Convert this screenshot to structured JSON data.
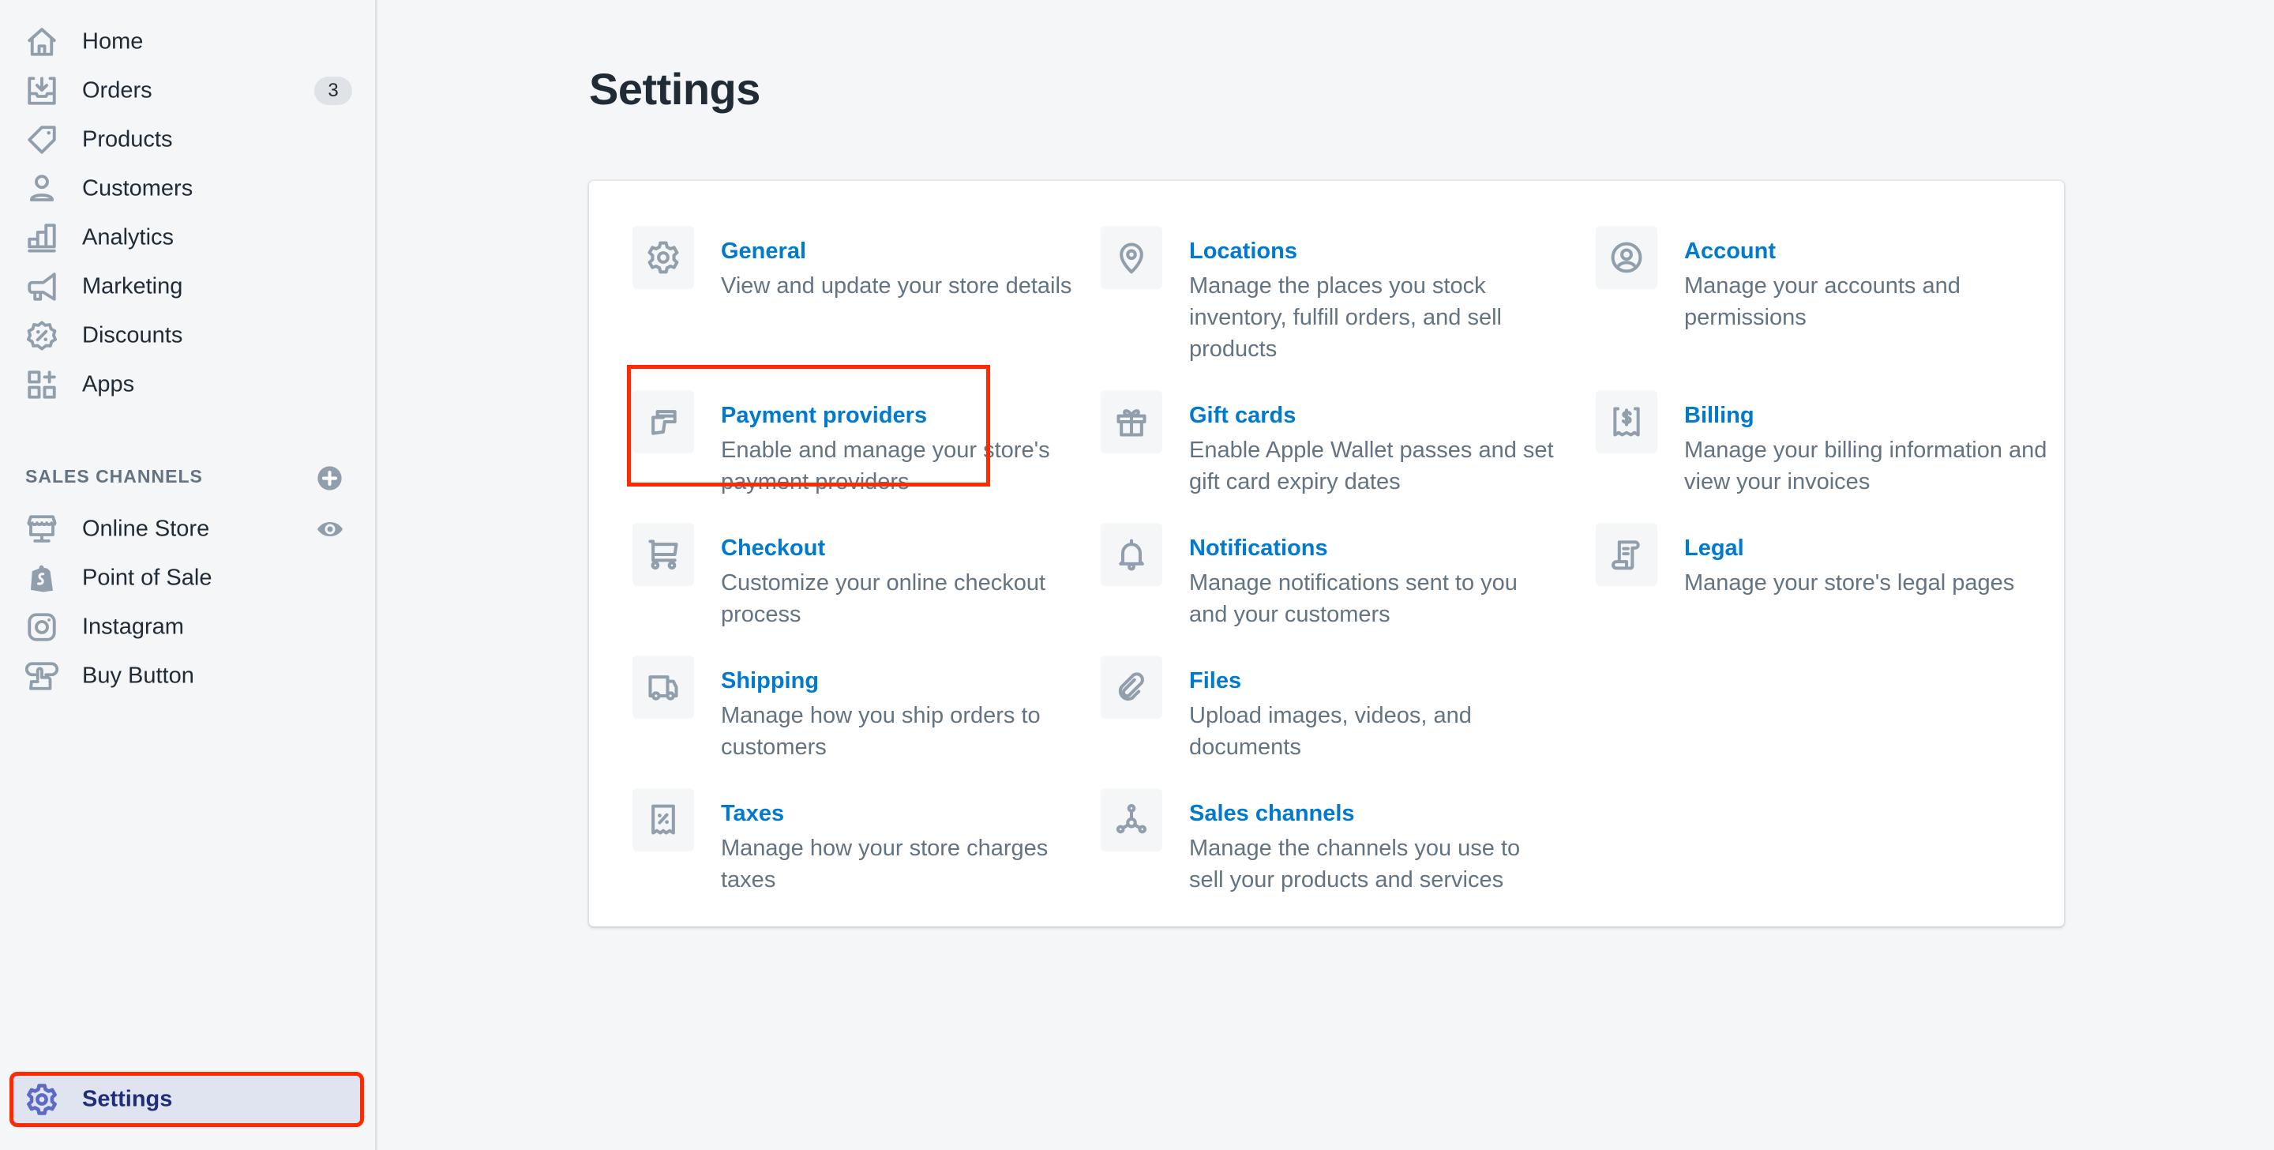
{
  "sidebar": {
    "items": [
      {
        "label": "Home",
        "icon": "home-icon"
      },
      {
        "label": "Orders",
        "icon": "orders-icon",
        "badge": "3"
      },
      {
        "label": "Products",
        "icon": "tag-icon"
      },
      {
        "label": "Customers",
        "icon": "person-icon"
      },
      {
        "label": "Analytics",
        "icon": "bar-chart-icon"
      },
      {
        "label": "Marketing",
        "icon": "megaphone-icon"
      },
      {
        "label": "Discounts",
        "icon": "discount-icon"
      },
      {
        "label": "Apps",
        "icon": "apps-icon"
      }
    ],
    "sales_channels": {
      "heading": "SALES CHANNELS",
      "items": [
        {
          "label": "Online Store",
          "icon": "storefront-icon"
        },
        {
          "label": "Point of Sale",
          "icon": "shopify-bag-icon"
        },
        {
          "label": "Instagram",
          "icon": "instagram-icon"
        },
        {
          "label": "Buy Button",
          "icon": "buy-button-icon"
        }
      ]
    },
    "settings": {
      "label": "Settings",
      "icon": "gear-icon",
      "active": true
    }
  },
  "main": {
    "title": "Settings",
    "settings": [
      {
        "title": "General",
        "desc": "View and update your store details",
        "icon": "gear-icon"
      },
      {
        "title": "Locations",
        "desc": "Manage the places you stock inventory, fulfill orders, and sell products",
        "icon": "location-pin-icon"
      },
      {
        "title": "Account",
        "desc": "Manage your accounts and permissions",
        "icon": "account-circle-icon"
      },
      {
        "title": "Payment providers",
        "desc": "Enable and manage your store's payment providers",
        "icon": "credit-cards-icon"
      },
      {
        "title": "Gift cards",
        "desc": "Enable Apple Wallet passes and set gift card expiry dates",
        "icon": "gift-icon"
      },
      {
        "title": "Billing",
        "desc": "Manage your billing information and view your invoices",
        "icon": "billing-receipt-icon"
      },
      {
        "title": "Checkout",
        "desc": "Customize your online checkout process",
        "icon": "cart-icon"
      },
      {
        "title": "Notifications",
        "desc": "Manage notifications sent to you and your customers",
        "icon": "bell-icon"
      },
      {
        "title": "Legal",
        "desc": "Manage your store's legal pages",
        "icon": "scroll-icon"
      },
      {
        "title": "Shipping",
        "desc": "Manage how you ship orders to customers",
        "icon": "truck-icon"
      },
      {
        "title": "Files",
        "desc": "Upload images, videos, and documents",
        "icon": "paperclip-icon"
      },
      {
        "title": "Taxes",
        "desc": "Manage how your store charges taxes",
        "icon": "tax-receipt-icon"
      },
      {
        "title": "Sales channels",
        "desc": "Manage the channels you use to sell your products and services",
        "icon": "channels-icon"
      }
    ]
  },
  "colors": {
    "link": "#007ace",
    "icon": "#919eab",
    "active_nav_bg": "#e0e4f0",
    "active_nav_text": "#202e78",
    "active_icon": "#5c6ac4",
    "annotation_red": "#ff2a00"
  }
}
